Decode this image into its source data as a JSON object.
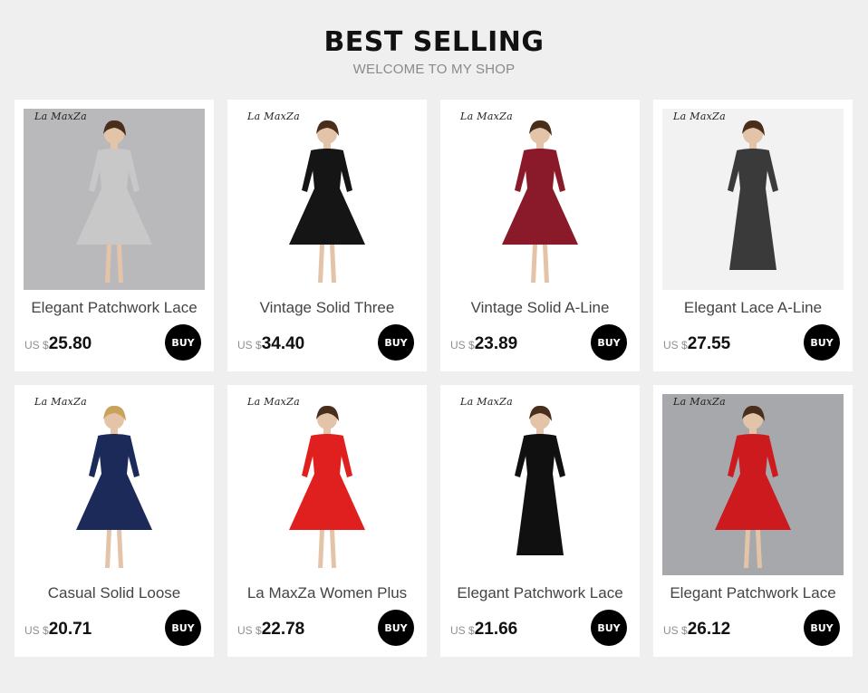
{
  "header": {
    "title": "BEST SELLING",
    "subtitle": "WELCOME TO MY SHOP"
  },
  "buy_label": "BUY",
  "currency": "US $",
  "brand": "La MaxZa",
  "products": [
    {
      "name": "Elegant Patchwork Lace",
      "price": "25.80",
      "dress_color": "#c8c8c8",
      "bg_color": "#b9b9bb"
    },
    {
      "name": "Vintage Solid Three",
      "price": "34.40",
      "dress_color": "#151515",
      "bg_color": "#ffffff"
    },
    {
      "name": "Vintage Solid A-Line",
      "price": "23.89",
      "dress_color": "#8a1a2a",
      "bg_color": "#ffffff"
    },
    {
      "name": "Elegant Lace A-Line",
      "price": "27.55",
      "dress_color": "#3a3a3a",
      "bg_color": "#f2f2f2"
    },
    {
      "name": "Casual Solid Loose",
      "price": "20.71",
      "dress_color": "#1c2a5a",
      "bg_color": "#ffffff"
    },
    {
      "name": "La MaxZa Women Plus",
      "price": "22.78",
      "dress_color": "#e0201e",
      "bg_color": "#ffffff"
    },
    {
      "name": "Elegant Patchwork Lace",
      "price": "21.66",
      "dress_color": "#101010",
      "bg_color": "#ffffff"
    },
    {
      "name": "Elegant Patchwork Lace",
      "price": "26.12",
      "dress_color": "#cc1a1e",
      "bg_color": "#a6a8ab"
    }
  ]
}
